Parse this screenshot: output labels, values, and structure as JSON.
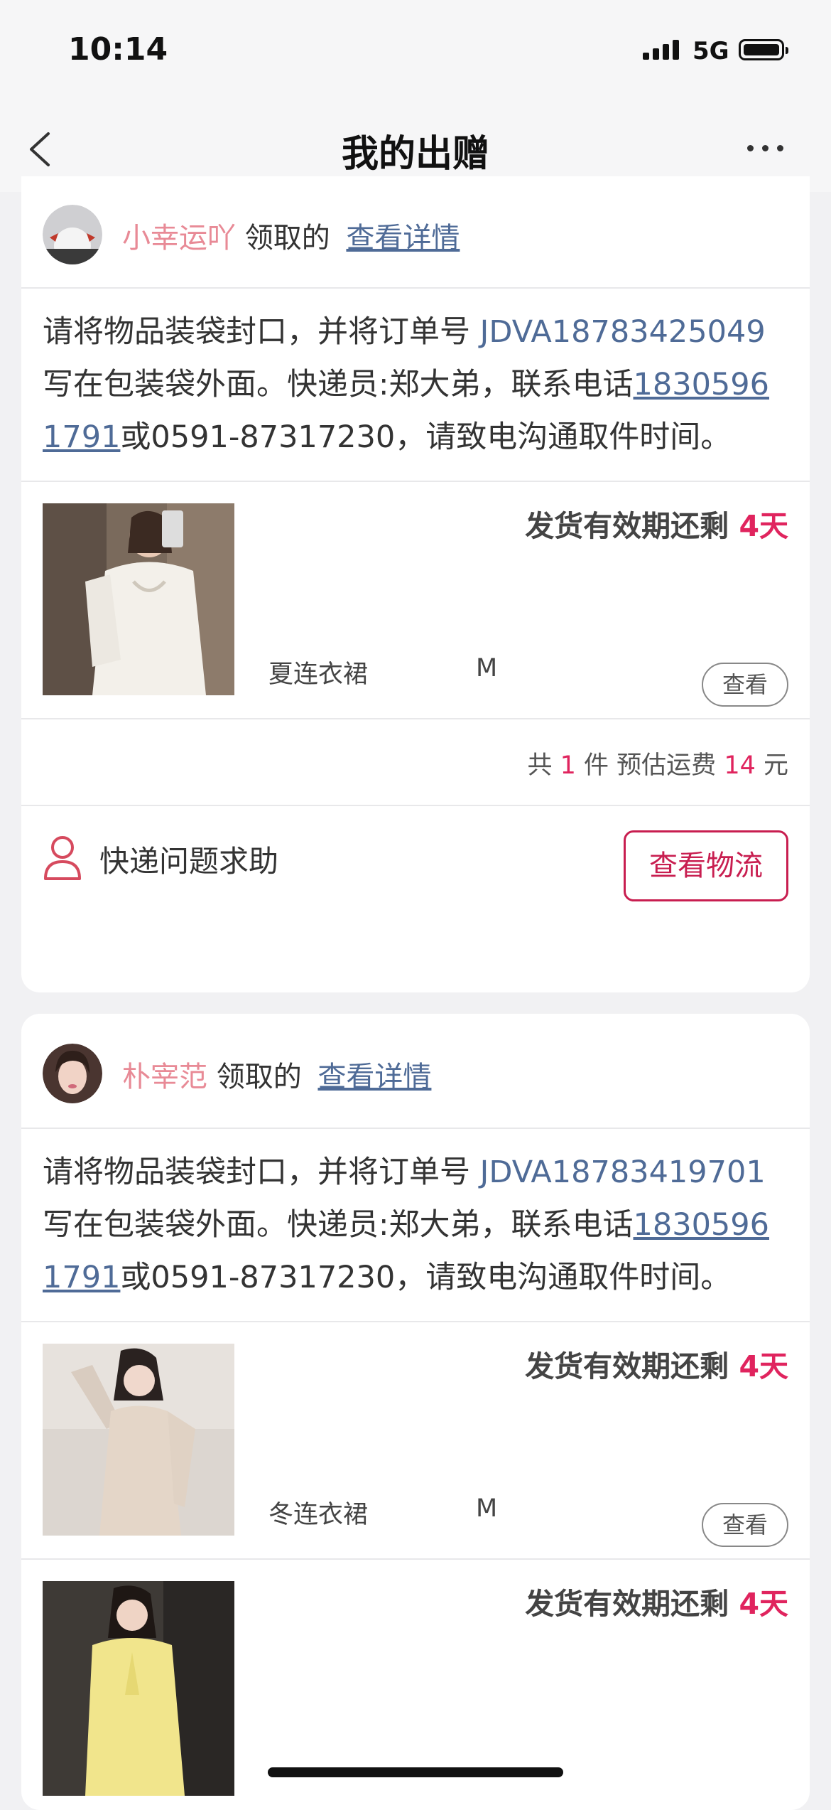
{
  "status_bar": {
    "time": "10:14",
    "network": "5G"
  },
  "header": {
    "title": "我的出赠"
  },
  "gifts": [
    {
      "user_name": "小幸运吖",
      "received_label": "领取的",
      "detail_link": "查看详情",
      "notice": {
        "prefix": "请将物品装袋封口，并将订单号 ",
        "order_no": "JDVA18783425049",
        "middle": " 写在包装袋外面。快递员:郑大弟，联系电话",
        "phone": "18305961791",
        "suffix": "或0591-87317230，请致电沟通取件时间。"
      },
      "items": [
        {
          "deadline_label": "发货有效期还剩 ",
          "days": "4天",
          "name": "夏连衣裙",
          "size": "M",
          "view_label": "查看"
        }
      ],
      "summary": {
        "p1": "共 ",
        "count": "1",
        "p2": " 件 预估运费 ",
        "fee": "14",
        "p3": " 元"
      },
      "help_label": "快递问题求助",
      "track_label": "查看物流"
    },
    {
      "user_name": "朴宰范",
      "received_label": "领取的",
      "detail_link": "查看详情",
      "notice": {
        "prefix": "请将物品装袋封口，并将订单号 ",
        "order_no": "JDVA18783419701",
        "middle": " 写在包装袋外面。快递员:郑大弟，联系电话",
        "phone": "18305961791",
        "suffix": "或0591-87317230，请致电沟通取件时间。"
      },
      "items": [
        {
          "deadline_label": "发货有效期还剩 ",
          "days": "4天",
          "name": "冬连衣裙",
          "size": "M",
          "view_label": "查看"
        },
        {
          "deadline_label": "发货有效期还剩 ",
          "days": "4天"
        }
      ]
    }
  ],
  "colors": {
    "accent": "#e0245e",
    "link": "#4f6b97",
    "username": "#e88a96",
    "button_border": "#c81e50"
  }
}
